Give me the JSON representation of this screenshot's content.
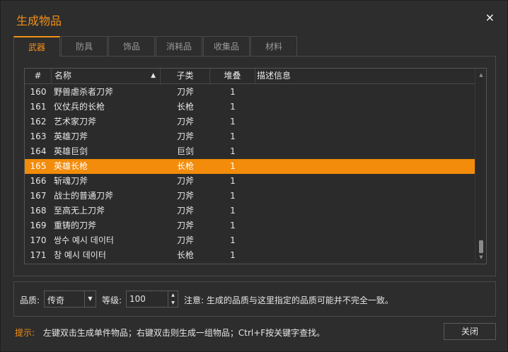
{
  "window": {
    "title": "生成物品",
    "close_glyph": "×"
  },
  "tabs": [
    {
      "label": "武器",
      "active": true
    },
    {
      "label": "防具",
      "active": false
    },
    {
      "label": "饰品",
      "active": false
    },
    {
      "label": "消耗品",
      "active": false
    },
    {
      "label": "收集品",
      "active": false
    },
    {
      "label": "材料",
      "active": false
    }
  ],
  "grid": {
    "columns": {
      "num": "#",
      "name": "名称",
      "subtype": "子类",
      "stack": "堆叠",
      "desc": "描述信息"
    },
    "sort_arrow": "▲",
    "rows": [
      {
        "num": "160",
        "name": "野兽虐杀者刀斧",
        "subtype": "刀斧",
        "stack": "1",
        "desc": "",
        "selected": false
      },
      {
        "num": "161",
        "name": "仪仗兵的长枪",
        "subtype": "长枪",
        "stack": "1",
        "desc": "",
        "selected": false
      },
      {
        "num": "162",
        "name": "艺术家刀斧",
        "subtype": "刀斧",
        "stack": "1",
        "desc": "",
        "selected": false
      },
      {
        "num": "163",
        "name": "英雄刀斧",
        "subtype": "刀斧",
        "stack": "1",
        "desc": "",
        "selected": false
      },
      {
        "num": "164",
        "name": "英雄巨剑",
        "subtype": "巨剑",
        "stack": "1",
        "desc": "",
        "selected": false
      },
      {
        "num": "165",
        "name": "英雄长枪",
        "subtype": "长枪",
        "stack": "1",
        "desc": "",
        "selected": true
      },
      {
        "num": "166",
        "name": "斩魂刀斧",
        "subtype": "刀斧",
        "stack": "1",
        "desc": "",
        "selected": false
      },
      {
        "num": "167",
        "name": "战士的普通刀斧",
        "subtype": "刀斧",
        "stack": "1",
        "desc": "",
        "selected": false
      },
      {
        "num": "168",
        "name": "至高无上刀斧",
        "subtype": "刀斧",
        "stack": "1",
        "desc": "",
        "selected": false
      },
      {
        "num": "169",
        "name": "重铸的刀斧",
        "subtype": "刀斧",
        "stack": "1",
        "desc": "",
        "selected": false
      },
      {
        "num": "170",
        "name": "쌍수 예시 데이터",
        "subtype": "刀斧",
        "stack": "1",
        "desc": "",
        "selected": false
      },
      {
        "num": "171",
        "name": "창 예시 데이터",
        "subtype": "长枪",
        "stack": "1",
        "desc": "",
        "selected": false
      }
    ],
    "scroll_up_glyph": "▲",
    "scroll_down_glyph": "▼"
  },
  "options": {
    "quality_label": "品质:",
    "quality_value": "传奇",
    "level_label": "等级:",
    "level_value": "100",
    "note": "注意: 生成的品质与这里指定的品质可能并不完全一致。",
    "dropdown_glyph": "▼",
    "spin_up_glyph": "▲",
    "spin_down_glyph": "▼"
  },
  "footer": {
    "tip_label": "提示:",
    "tip_text": "左键双击生成单件物品；右键双击则生成一组物品；Ctrl+F按关键字查找。",
    "close_label": "关闭"
  },
  "colors": {
    "accent": "#f39019",
    "selected_row": "#f28c0a",
    "background": "#2d2d2d"
  }
}
